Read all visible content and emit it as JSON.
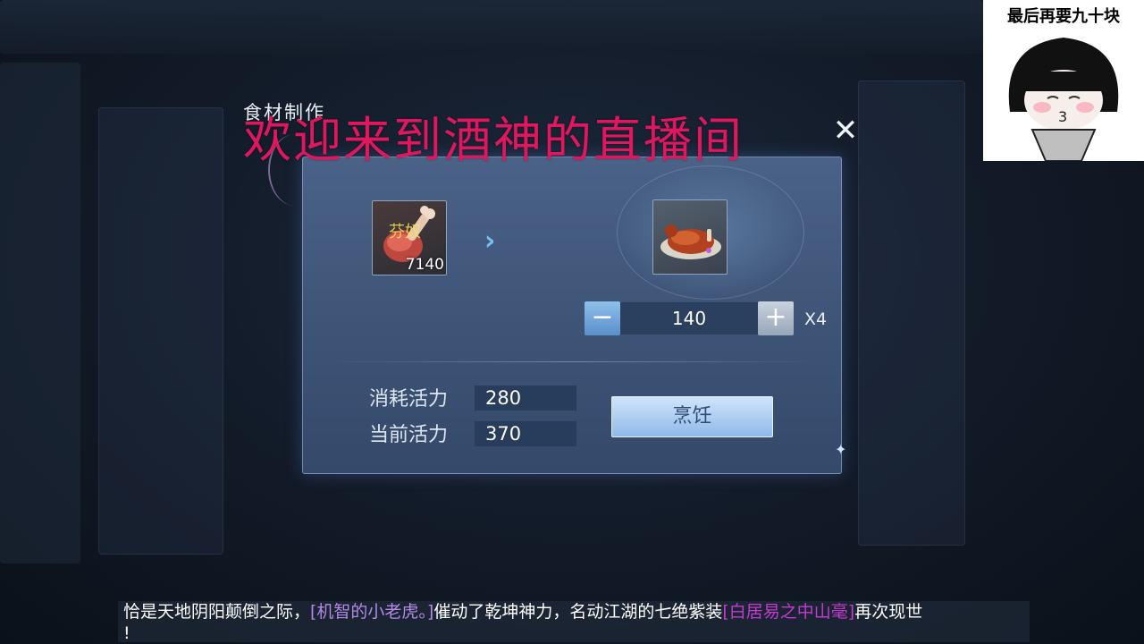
{
  "panel": {
    "title": "食材制作",
    "close_icon": "close-icon"
  },
  "watermark": {
    "text": "欢迎来到酒神的直播间",
    "color": "#e0175e"
  },
  "recipe": {
    "input_item": {
      "icon": "roast-leg-icon",
      "tag": "芬奴",
      "quantity": "7140"
    },
    "arrow_icon": "double-chevron-right-icon",
    "output_item": {
      "icon": "roast-duck-icon"
    }
  },
  "stepper": {
    "minus_label": "−",
    "plus_label": "+",
    "value": "140",
    "multiplier": "X4"
  },
  "stats": {
    "cost_label": "消耗活力",
    "cost_value": "280",
    "current_label": "当前活力",
    "current_value": "370"
  },
  "actions": {
    "cook_label": "烹饪"
  },
  "meme": {
    "caption": "最后再要九十块",
    "face_mouth": "3"
  },
  "ticker": {
    "part1": "恰是天地阴阳颠倒之际，",
    "player": "[机智的小老虎。]",
    "part2": "催动了乾坤神力，名动江湖的七绝紫装",
    "item": "[白居易之中山毫]",
    "part3": "再次现世",
    "part4": "!",
    "colors": {
      "player": "#b28ae6",
      "item": "#c53ad1"
    }
  }
}
